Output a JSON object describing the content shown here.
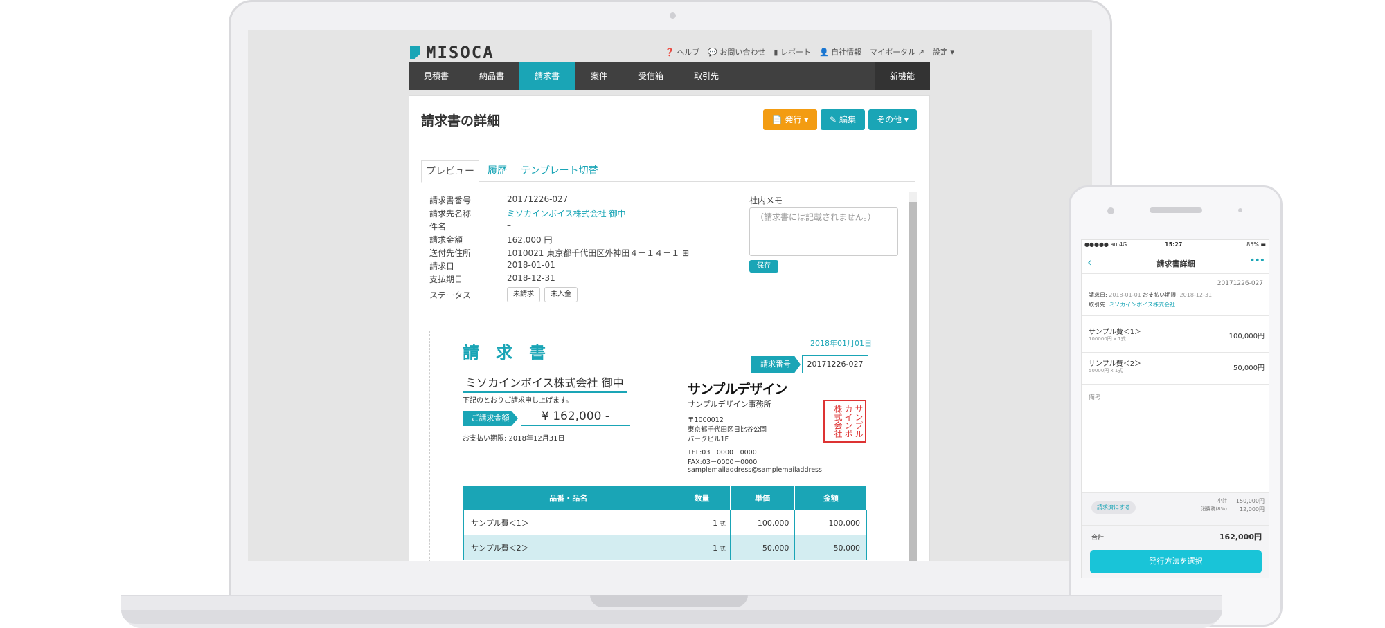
{
  "app": {
    "logo_text": "MISOCA",
    "top_links": [
      "ヘルプ",
      "お問い合わせ",
      "レポート",
      "自社情報",
      "マイポータル",
      "設定"
    ],
    "nav": [
      "見積書",
      "納品書",
      "請求書",
      "案件",
      "受信箱",
      "取引先"
    ],
    "nav_right": "新機能",
    "page_title": "請求書の詳細",
    "buttons": {
      "issue": "発行",
      "edit": "編集",
      "other": "その他"
    },
    "tabs": [
      "プレビュー",
      "履歴",
      "テンプレート切替"
    ],
    "details": [
      {
        "label": "請求書番号",
        "value": "20171226-027"
      },
      {
        "label": "請求先名称",
        "value": "ミソカインボイス株式会社 御中"
      },
      {
        "label": "件名",
        "value": "–"
      },
      {
        "label": "請求金額",
        "value": "162,000 円"
      },
      {
        "label": "送付先住所",
        "value": "1010021 東京都千代田区外神田４－１４－１"
      },
      {
        "label": "請求日",
        "value": "2018-01-01"
      },
      {
        "label": "支払期日",
        "value": "2018-12-31"
      },
      {
        "label": "ステータス",
        "value": ""
      }
    ],
    "status_badges": [
      "未請求",
      "未入金"
    ],
    "memo_label": "社内メモ",
    "memo_placeholder": "（請求書には記載されません。）",
    "save_label": "保存",
    "colors": {
      "accent": "#1aa5b6",
      "issue": "#f39c12",
      "nav": "#404040"
    }
  },
  "invoice": {
    "title": "請　求　書",
    "date": "2018年01月01日",
    "number_label": "請求番号",
    "number": "20171226-027",
    "customer": "ミソカインボイス株式会社 御中",
    "note": "下記のとおりご請求申し上げます。",
    "amount_label": "ご請求金額",
    "amount": "¥ 162,000 -",
    "due": "お支払い期限: 2018年12月31日",
    "company_logo": "サンプルデザイン",
    "company_name": "サンプルデザイン事務所",
    "zip": "〒1000012",
    "address1": "東京都千代田区日比谷公園",
    "address2": "パークビル1F",
    "tel": "TEL:03－0000－0000",
    "fax": "FAX:03－0000－0000",
    "email": "samplemailaddress@samplemailaddress",
    "stamp": "サンプルカインボ株式会社",
    "table_headers": [
      "品番・品名",
      "数量",
      "単価",
      "金額"
    ],
    "rows": [
      {
        "name": "サンプル費＜1＞",
        "qty": "1",
        "unit": "式",
        "price": "100,000",
        "total": "100,000"
      },
      {
        "name": "サンプル費＜2＞",
        "qty": "1",
        "unit": "式",
        "price": "50,000",
        "total": "50,000"
      }
    ]
  },
  "mobile": {
    "status_left": "●●●●● au 4G",
    "status_time": "15:27",
    "status_battery": "85%",
    "title": "請求書詳細",
    "number": "20171226-027",
    "dates_label1": "請求日:",
    "date1": "2018-01-01",
    "dates_label2": "お支払い期限:",
    "date2": "2018-12-31",
    "client_label": "取引先:",
    "client": "ミソカインボイス株式会社",
    "items": [
      {
        "name": "サンプル費＜1＞",
        "sub": "100000円 x 1式",
        "amount": "100,000円"
      },
      {
        "name": "サンプル費＜2＞",
        "sub": "50000円 x 1式",
        "amount": "50,000円"
      }
    ],
    "remarks_label": "備考",
    "mark_paid": "請求済にする",
    "subtotal_label": "小計",
    "subtotal": "150,000円",
    "tax_label": "消費税(8%)",
    "tax": "12,000円",
    "total_label": "合計",
    "total": "162,000円",
    "cta": "発行方法を選択"
  }
}
